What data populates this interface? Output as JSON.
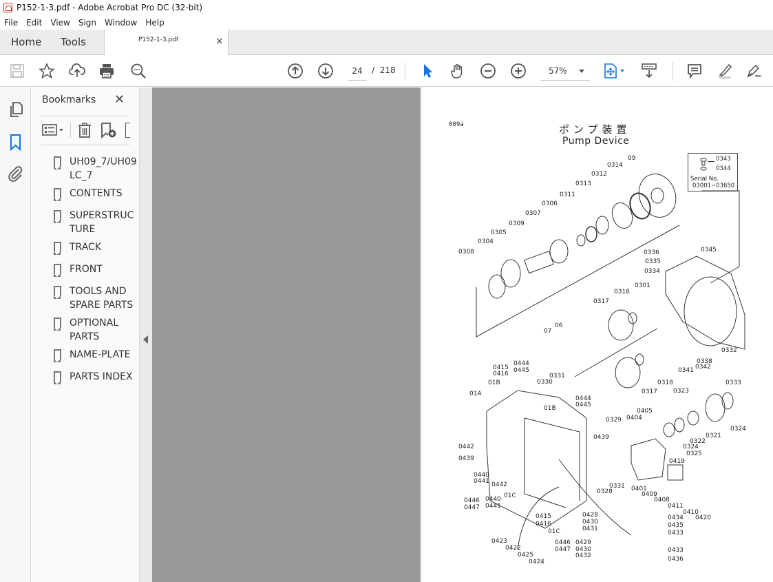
{
  "window": {
    "title": "P152-1-3.pdf - Adobe Acrobat Pro DC (32-bit)"
  },
  "menu": [
    "File",
    "Edit",
    "View",
    "Sign",
    "Window",
    "Help"
  ],
  "tabs": {
    "home": "Home",
    "tools": "Tools",
    "document": "P152-1-3.pdf",
    "close": "×"
  },
  "toolbar": {
    "left_icons": [
      "save-icon",
      "bookmark-star-icon",
      "upload-cloud-icon",
      "print-icon",
      "search-zoom-icon"
    ],
    "current_page": "24",
    "page_separator": "/",
    "total_pages": "218",
    "zoom_level": "57%",
    "accent_color": "#1473e6"
  },
  "left_rail": {
    "icons": [
      "page-thumbnails-icon",
      "bookmarks-icon",
      "attachments-icon"
    ]
  },
  "bookmarks_panel": {
    "title": "Bookmarks",
    "items": [
      {
        "label": "UH09_7/UH09\nLC_7",
        "line1": "UH09_7/UH09",
        "line2": "LC_7"
      },
      {
        "label": "CONTENTS",
        "line1": "CONTENTS",
        "line2": ""
      },
      {
        "label": "SUPERSTRUCTURE",
        "line1": "SUPERSTRUC",
        "line2": "TURE"
      },
      {
        "label": "TRACK",
        "line1": "TRACK",
        "line2": ""
      },
      {
        "label": "FRONT",
        "line1": "FRONT",
        "line2": ""
      },
      {
        "label": "TOOLS AND SPARE PARTS",
        "line1": "TOOLS AND",
        "line2": "SPARE PARTS"
      },
      {
        "label": "OPTIONAL PARTS",
        "line1": "OPTIONAL",
        "line2": "PARTS"
      },
      {
        "label": "NAME-PLATE",
        "line1": "NAME-PLATE",
        "line2": ""
      },
      {
        "label": "PARTS INDEX",
        "line1": "PARTS INDEX",
        "line2": ""
      }
    ]
  },
  "document_page": {
    "page_id": "009a",
    "title_jp": "ポンプ装置",
    "title_en": "Pump Device",
    "serial_box": {
      "parts": [
        "0343",
        "0344"
      ],
      "serial_label": "Serial No.",
      "serial_range": "03001~03650"
    },
    "part_labels": [
      "09",
      "0314",
      "0312",
      "0313",
      "0311",
      "0306",
      "0307",
      "0309",
      "0305",
      "0304",
      "0308",
      "0336",
      "0335",
      "0334",
      "0345",
      "0301",
      "0318",
      "0317",
      "06",
      "07",
      "0332",
      "0338",
      "0342",
      "0341",
      "0333",
      "0318",
      "0317",
      "0323",
      "0324",
      "0321",
      "0322",
      "0324",
      "0325",
      "0415",
      "0416",
      "0444",
      "0445",
      "0331",
      "0330",
      "01B",
      "01A",
      "01B",
      "0444",
      "0445",
      "0329",
      "0439",
      "0405",
      "0404",
      "0419",
      "0442",
      "0439",
      "0440",
      "0441",
      "0442",
      "01C",
      "0446",
      "0447",
      "0440",
      "0441",
      "0328",
      "0331",
      "0401",
      "0409",
      "0408",
      "0411",
      "0410",
      "0420",
      "0415",
      "0416",
      "01C",
      "0428",
      "0430",
      "0431",
      "0434",
      "0435",
      "0433",
      "0423",
      "0422",
      "0425",
      "0424",
      "0446",
      "0447",
      "0429",
      "0430",
      "0432",
      "0433",
      "0436"
    ]
  }
}
